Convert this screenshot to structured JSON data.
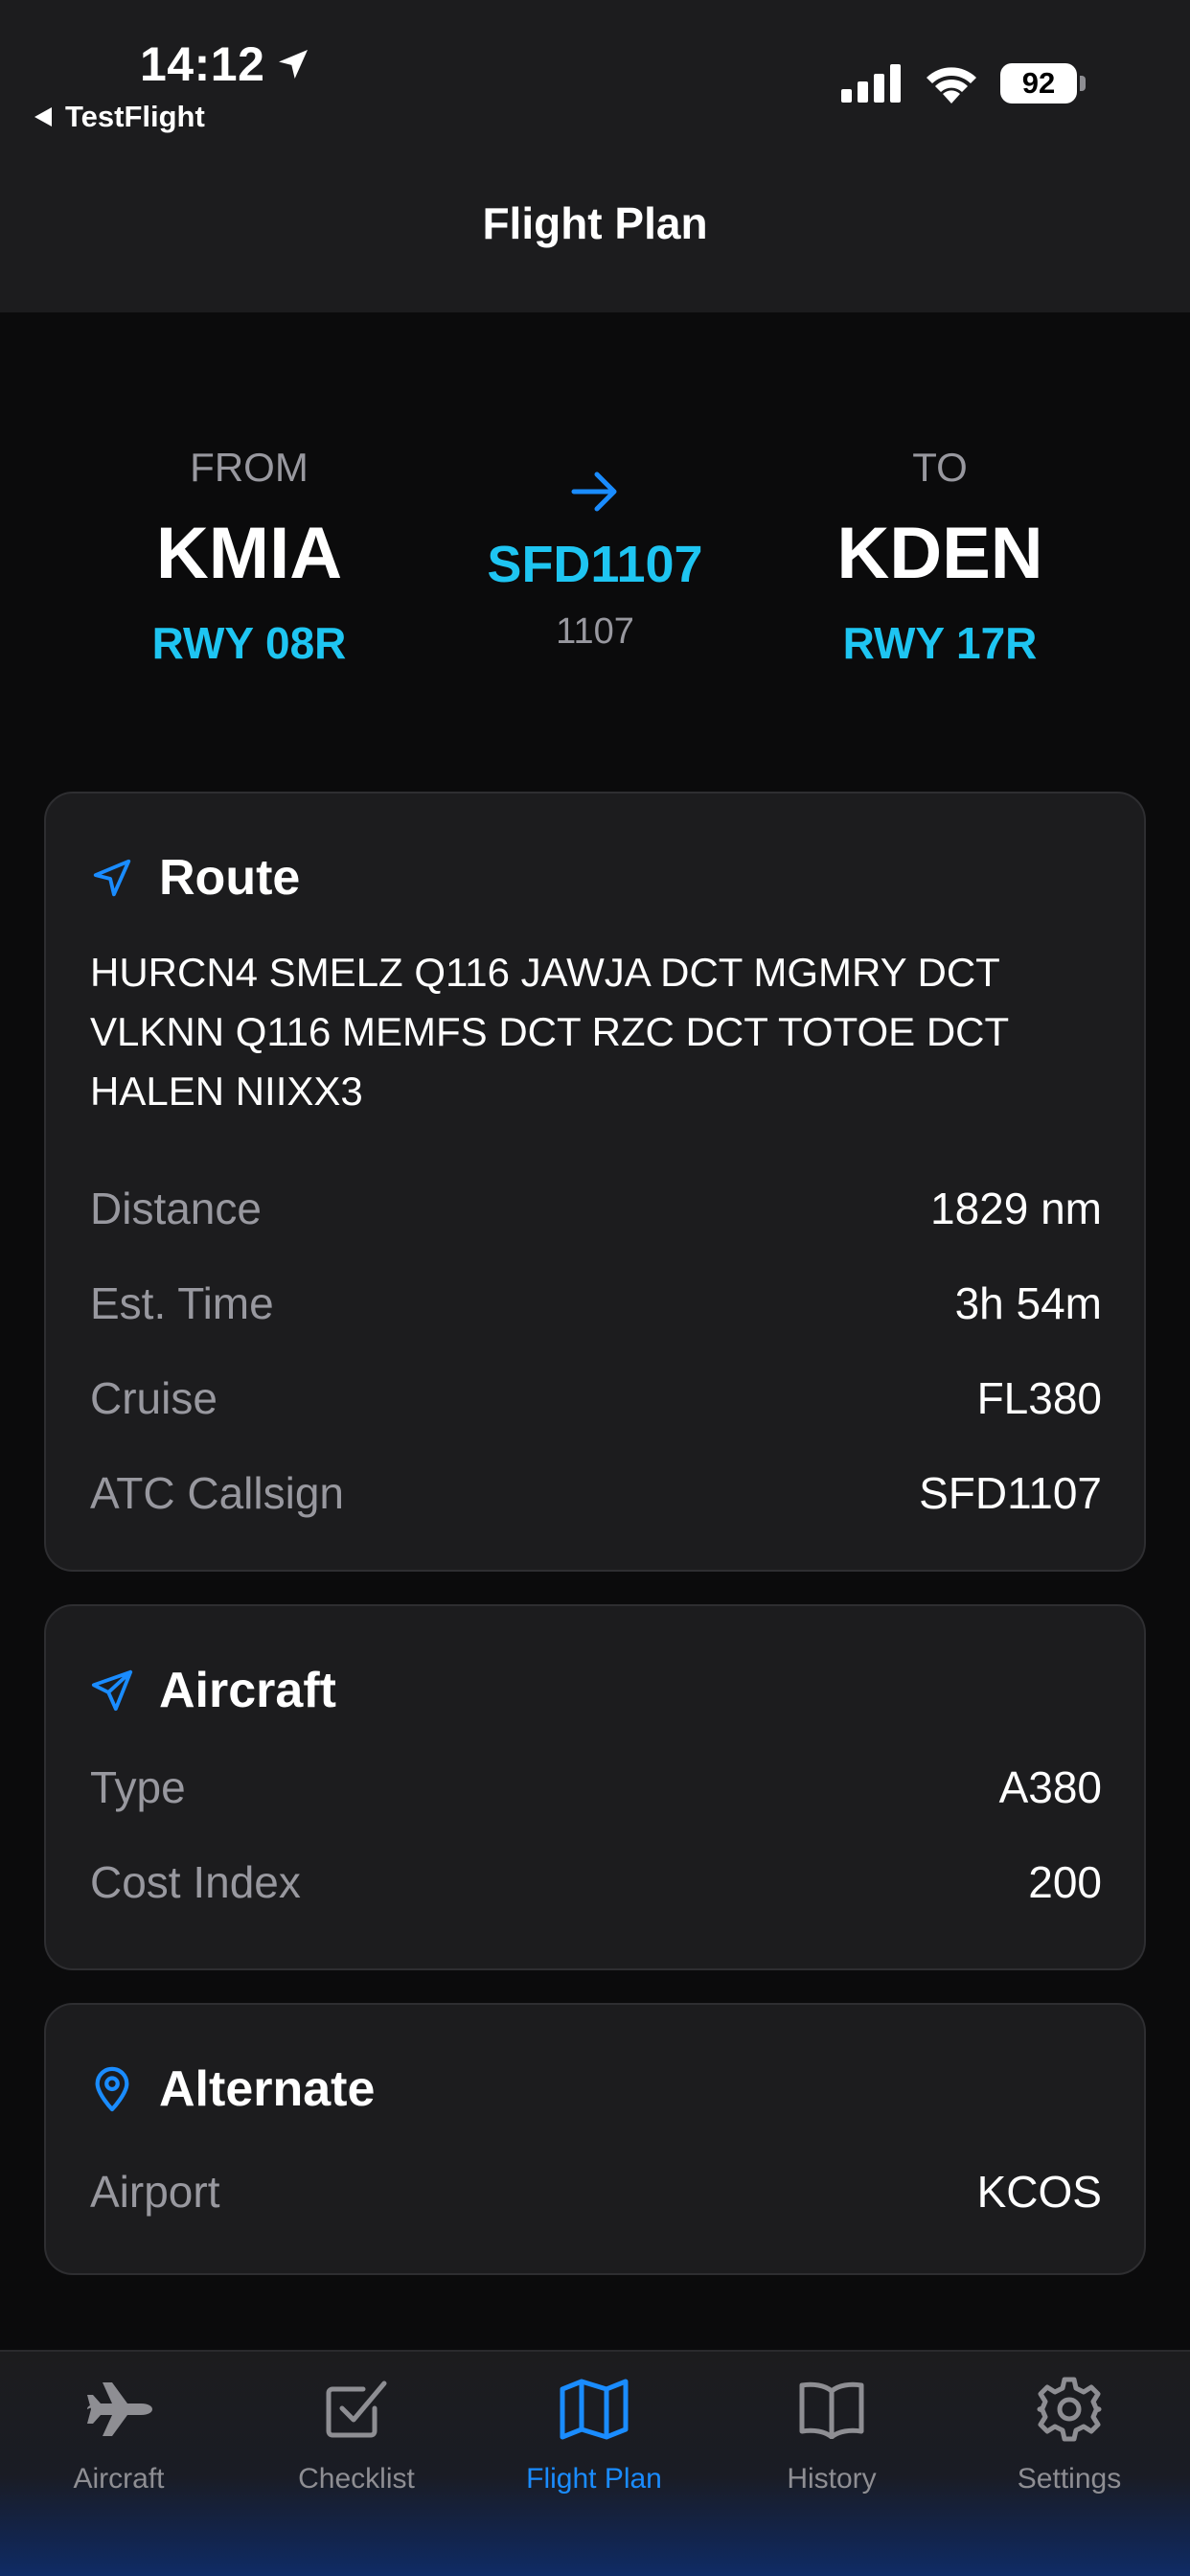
{
  "status_bar": {
    "time": "14:12",
    "back_app": "TestFlight",
    "battery": "92"
  },
  "nav": {
    "title": "Flight Plan"
  },
  "summary": {
    "from_label": "FROM",
    "from_airport": "KMIA",
    "from_runway": "RWY 08R",
    "flight_code": "SFD1107",
    "flight_number": "1107",
    "to_label": "TO",
    "to_airport": "KDEN",
    "to_runway": "RWY 17R"
  },
  "route_card": {
    "title": "Route",
    "icon": "location-arrow-icon",
    "route": "HURCN4 SMELZ Q116 JAWJA DCT MGMRY DCT VLKNN Q116 MEMFS DCT RZC DCT TOTOE DCT HALEN NIIXX3",
    "rows": [
      {
        "label": "Distance",
        "value": "1829 nm"
      },
      {
        "label": "Est. Time",
        "value": "3h 54m"
      },
      {
        "label": "Cruise",
        "value": "FL380"
      },
      {
        "label": "ATC Callsign",
        "value": "SFD1107"
      }
    ]
  },
  "aircraft_card": {
    "title": "Aircraft",
    "icon": "paper-plane-icon",
    "rows": [
      {
        "label": "Type",
        "value": "A380"
      },
      {
        "label": "Cost Index",
        "value": "200"
      }
    ]
  },
  "alternate_card": {
    "title": "Alternate",
    "icon": "map-pin-icon",
    "rows": [
      {
        "label": "Airport",
        "value": "KCOS"
      }
    ]
  },
  "tabs": [
    {
      "label": "Aircraft",
      "icon": "airplane-icon",
      "active": false
    },
    {
      "label": "Checklist",
      "icon": "checklist-icon",
      "active": false
    },
    {
      "label": "Flight Plan",
      "icon": "map-icon",
      "active": true
    },
    {
      "label": "History",
      "icon": "book-icon",
      "active": false
    },
    {
      "label": "Settings",
      "icon": "gear-icon",
      "active": false
    }
  ],
  "colors": {
    "accent_blue": "#1a8cff",
    "accent_cyan": "#1ec5f2",
    "card_bg": "#1c1c1e",
    "secondary_text": "#98989f"
  }
}
